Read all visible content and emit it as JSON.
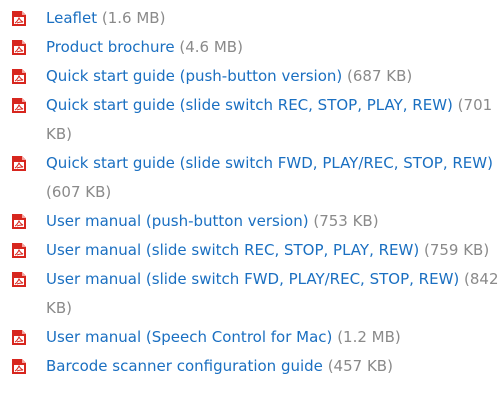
{
  "documents": [
    {
      "title": "Leaflet",
      "size": "(1.6 MB)"
    },
    {
      "title": "Product brochure",
      "size": "(4.6 MB)"
    },
    {
      "title": "Quick start guide (push-button version)",
      "size": "(687 KB)"
    },
    {
      "title": "Quick start guide (slide switch REC, STOP, PLAY, REW)",
      "size": "(701 KB)"
    },
    {
      "title": "Quick start guide (slide switch FWD, PLAY/REC, STOP, REW)",
      "size": "(607 KB)"
    },
    {
      "title": "User manual (push-button version)",
      "size": "(753 KB)"
    },
    {
      "title": "User manual (slide switch REC, STOP, PLAY, REW)",
      "size": "(759 KB)"
    },
    {
      "title": "User manual (slide switch FWD, PLAY/REC, STOP, REW)",
      "size": "(842 KB)"
    },
    {
      "title": "User manual (Speech Control for Mac)",
      "size": "(1.2 MB)"
    },
    {
      "title": "Barcode scanner configuration guide",
      "size": "(457 KB)"
    }
  ],
  "icon": "pdf-icon",
  "colors": {
    "link": "#1a6fc1",
    "size_text": "#8a8a8a",
    "icon_red": "#d7261e"
  }
}
